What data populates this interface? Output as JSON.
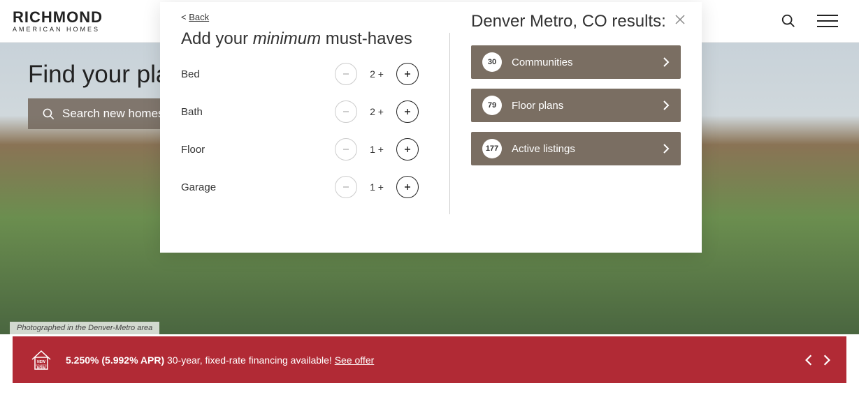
{
  "logo": {
    "top": "RICHMOND",
    "bottom": "AMERICAN HOMES"
  },
  "hero": {
    "title": "Find your place.",
    "search_label": "Search new homes",
    "caption": "Photographed in the Denver-Metro area"
  },
  "modal": {
    "back": "Back",
    "title_pre": "Add your ",
    "title_em": "minimum",
    "title_post": " must-haves",
    "filters": [
      {
        "label": "Bed",
        "value": "2 +"
      },
      {
        "label": "Bath",
        "value": "2 +"
      },
      {
        "label": "Floor",
        "value": "1 +"
      },
      {
        "label": "Garage",
        "value": "1 +"
      }
    ],
    "results_title": "Denver Metro, CO results:",
    "results": [
      {
        "count": "30",
        "label": "Communities"
      },
      {
        "count": "79",
        "label": "Floor plans"
      },
      {
        "count": "177",
        "label": "Active listings"
      }
    ]
  },
  "promo": {
    "rate": "5.250% (5.992% APR)",
    "text": " 30-year, fixed-rate financing available!  ",
    "link": "See offer"
  }
}
